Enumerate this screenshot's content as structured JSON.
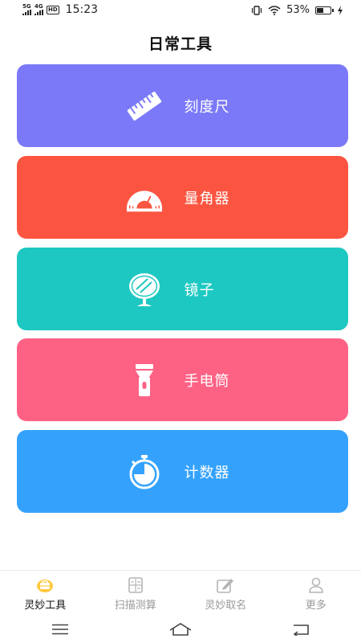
{
  "status_bar": {
    "network_1": "5G",
    "network_2": "4G",
    "hd_badge": "HD",
    "time": "15:23",
    "battery_percent": "53%",
    "battery_level": 0.53
  },
  "header": {
    "title": "日常工具"
  },
  "tools": [
    {
      "label": "刻度尺",
      "icon": "ruler-icon",
      "color": "#7b79f8"
    },
    {
      "label": "量角器",
      "icon": "protractor-icon",
      "color": "#fb5541"
    },
    {
      "label": "镜子",
      "icon": "mirror-icon",
      "color": "#1ec8c2"
    },
    {
      "label": "手电筒",
      "icon": "flashlight-icon",
      "color": "#fd6285"
    },
    {
      "label": "计数器",
      "icon": "stopwatch-icon",
      "color": "#34a2fd"
    }
  ],
  "tab_bar": {
    "active_color": "#ffc940",
    "tabs": [
      {
        "label": "灵妙工具",
        "icon": "toolbox-icon",
        "active": true
      },
      {
        "label": "扫描测算",
        "icon": "calculator-icon",
        "active": false
      },
      {
        "label": "灵妙取名",
        "icon": "edit-icon",
        "active": false
      },
      {
        "label": "更多",
        "icon": "person-icon",
        "active": false
      }
    ]
  }
}
